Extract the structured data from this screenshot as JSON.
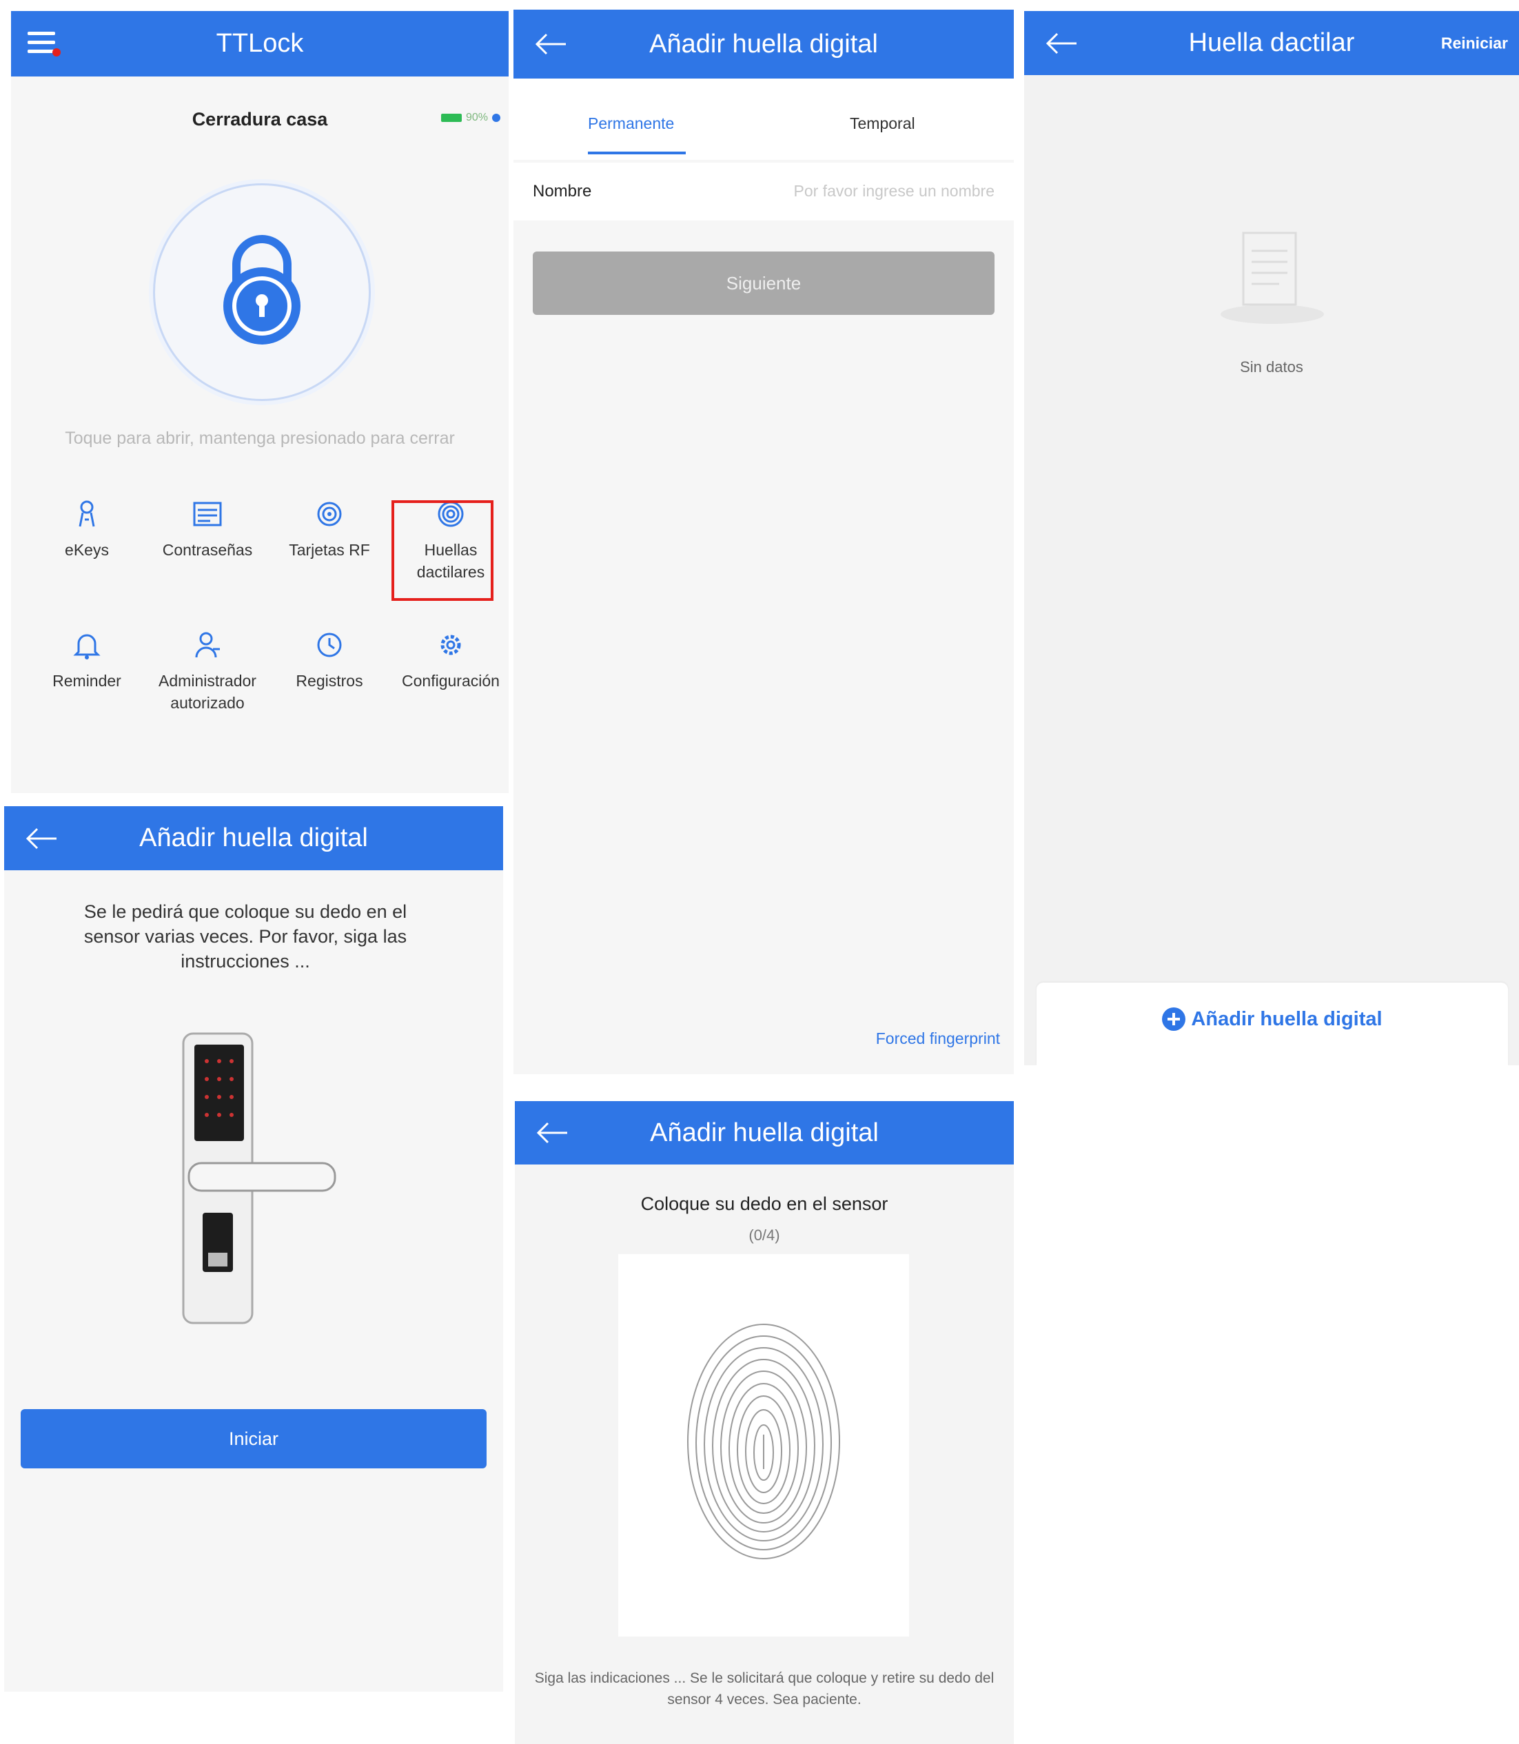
{
  "colors": {
    "accent": "#2f76e6",
    "highlight": "#e5201c",
    "disabled": "#a9a9a9"
  },
  "panel_home": {
    "app_title": "TTLock",
    "lock_name": "Cerradura casa",
    "battery": "90%",
    "hint": "Toque para abrir, mantenga presionado para cerrar",
    "items": [
      {
        "label": "eKeys",
        "icon": "ekey-icon"
      },
      {
        "label": "Contraseñas",
        "icon": "passcode-icon"
      },
      {
        "label": "Tarjetas RF",
        "icon": "card-icon"
      },
      {
        "label": "Huellas dactilares",
        "icon": "fingerprint-icon"
      },
      {
        "label": "Reminder",
        "icon": "bell-icon"
      },
      {
        "label": "Administrador autorizado",
        "icon": "admin-icon"
      },
      {
        "label": "Registros",
        "icon": "history-icon"
      },
      {
        "label": "Configuración",
        "icon": "gear-icon"
      }
    ]
  },
  "panel_instructions": {
    "title": "Añadir huella digital",
    "text": "Se le pedirá que coloque su dedo en el sensor varias veces. Por favor, siga las instrucciones ...",
    "start_button": "Iniciar"
  },
  "panel_form": {
    "title": "Añadir huella digital",
    "tabs": [
      "Permanente",
      "Temporal"
    ],
    "name_label": "Nombre",
    "name_placeholder": "Por favor ingrese un nombre",
    "next_button": "Siguiente",
    "forced_link": "Forced fingerprint"
  },
  "panel_scan": {
    "title": "Añadir huella digital",
    "prompt": "Coloque su dedo en el sensor",
    "progress": "(0/4)",
    "footer": "Siga las indicaciones ... Se le solicitará que coloque y retire su dedo del sensor 4 veces. Sea paciente."
  },
  "panel_list": {
    "title": "Huella dactilar",
    "reset": "Reiniciar",
    "empty": "Sin datos",
    "add_button": "Añadir huella digital"
  }
}
